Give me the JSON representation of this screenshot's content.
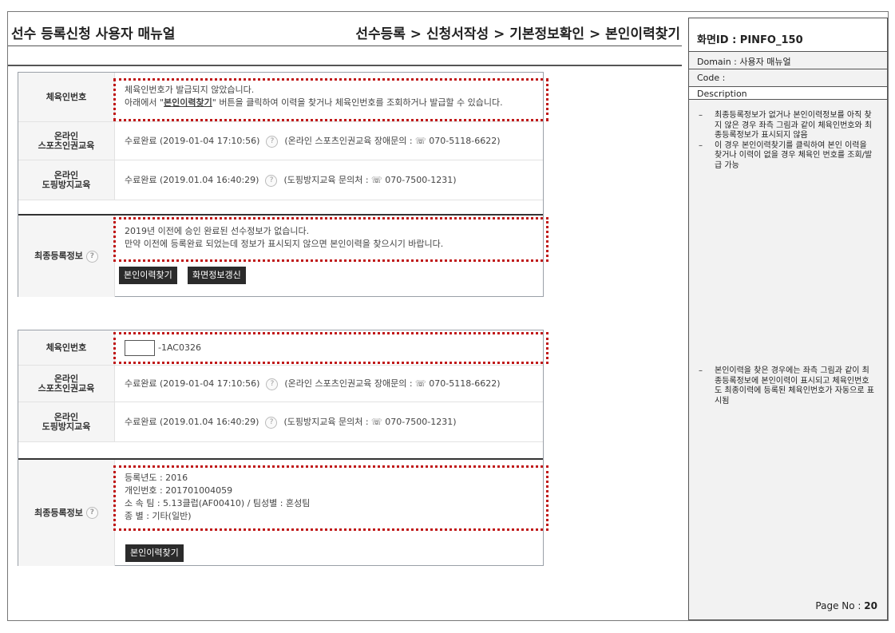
{
  "header": {
    "title": "선수 등록신청 사용자 매뉴얼",
    "breadcrumb": "선수등록 > 신청서작성 > 기본정보확인 > 본인이력찾기"
  },
  "sidebar": {
    "screen_id": "화면ID : PINFO_150",
    "domain": "Domain : 사용자 매뉴얼",
    "code": "Code :",
    "description_label": "Description",
    "notes": [
      {
        "dash": "–",
        "text": "최종등록정보가 없거나 본인이력정보를 아직 찾지 않은 경우 좌측 그림과 같이 체육인번호와 최종등록정보가 표시되지 않음"
      },
      {
        "dash": "–",
        "text": "이 경우 본인이력찾기를 클릭하여 본인 이력을 찾거나 이력이 없을 경우 체육인 번호를 조회/발급 가능"
      },
      {
        "dash": "–",
        "text": "본인이력을 찾은 경우에는 좌측 그림과 같이 최종등록정보에 본인이력이 표시되고 체육인번호도 최종이력에 등록된 체육인번호가 자동으로 표시됨"
      }
    ],
    "page_label": "Page No :",
    "page_no": "20"
  },
  "panel1": {
    "id_label": "체육인번호",
    "id_line1": "체육인번호가 발급되지 않았습니다.",
    "id_line2_a": "아래에서 \"",
    "id_line2_bold": "본인이력찾기",
    "id_line2_b": "\" 버튼을 클릭하여 이력을 찾거나 체육인번호를 조회하거나 발급할 수 있습니다.",
    "online_label_1": "온라인",
    "online_label_2": "스포츠인권교육",
    "online_value": "수료완료 (2019-01-04 17:10:56)",
    "online_contact": "(온라인 스포츠인권교육 장애문의 : ☏ 070-5118-6622)",
    "doping_label_1": "온라인",
    "doping_label_2": "도핑방지교육",
    "doping_value": "수료완료 (2019.01.04 16:40:29)",
    "doping_contact": "(도핑방지교육 문의처 : ☏ 070-7500-1231)",
    "final_label": "최종등록정보",
    "final_line1": "2019년 이전에 승인 완료된 선수정보가 없습니다.",
    "final_line2": "만약 이전에 등록완료 되었는데 정보가 표시되지 않으면 본인이력을 찾으시기 바랍니다.",
    "btn_find": "본인이력찾기",
    "btn_refresh": "화면정보갱신"
  },
  "panel2": {
    "id_label": "체육인번호",
    "id_value": "-1AC0326",
    "online_label_1": "온라인",
    "online_label_2": "스포츠인권교육",
    "online_value": "수료완료 (2019-01-04 17:10:56)",
    "online_contact": "(온라인 스포츠인권교육 장애문의 : ☏ 070-5118-6622)",
    "doping_label_1": "온라인",
    "doping_label_2": "도핑방지교육",
    "doping_value": "수료완료 (2019.01.04 16:40:29)",
    "doping_contact": "(도핑방지교육 문의처 : ☏ 070-7500-1231)",
    "final_label": "최종등록정보",
    "final_lines": [
      "등록년도 : 2016",
      "개인번호 : 201701004059",
      "소 속 팀 : 5.13클럽(AF00410) / 팀성별 : 혼성팀",
      "종      별 : 기타(일반)"
    ],
    "btn_find": "본인이력찾기"
  },
  "help_icon": "?"
}
